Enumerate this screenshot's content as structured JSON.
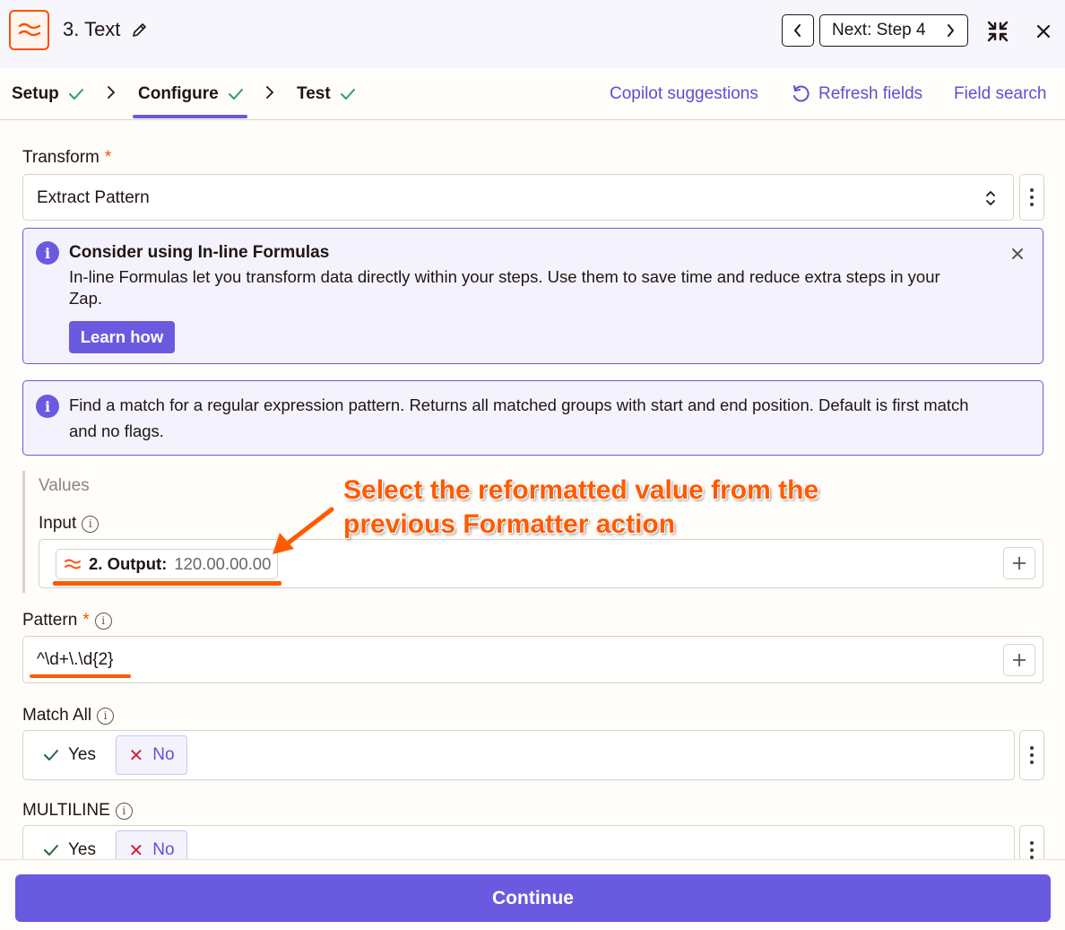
{
  "header": {
    "step_title": "3. Text",
    "next_label": "Next: Step 4"
  },
  "tabs": [
    {
      "label": "Setup"
    },
    {
      "label": "Configure"
    },
    {
      "label": "Test"
    }
  ],
  "tab_links": {
    "copilot": "Copilot suggestions",
    "refresh": "Refresh fields",
    "search": "Field search"
  },
  "transform": {
    "label": "Transform",
    "required": "*",
    "value": "Extract Pattern"
  },
  "formula_alert": {
    "title": "Consider using In-line Formulas",
    "line1": "In-line Formulas let you transform data directly within your steps. Use them to save time and reduce extra steps in your",
    "line2": "Zap.",
    "button": "Learn how"
  },
  "description_alert": {
    "line1": "Find a match for a regular expression pattern. Returns all matched groups with start and end position. Default is first match",
    "line2": "and no flags."
  },
  "values": {
    "heading": "Values",
    "input_label": "Input",
    "pill_key": "2. Output:",
    "pill_value": "120.00.00.00"
  },
  "pattern": {
    "label": "Pattern",
    "required": "*",
    "value": "^\\d+\\.\\d{2}"
  },
  "match_all": {
    "label": "Match All",
    "yes": "Yes",
    "no": "No"
  },
  "multiline": {
    "label": "MULTILINE",
    "yes": "Yes",
    "no": "No"
  },
  "footer": {
    "continue": "Continue"
  },
  "annotation": {
    "line1": "Select the reformatted value from the",
    "line2": "previous Formatter action"
  },
  "colors": {
    "accent": "#6a5ae0",
    "brand_orange": "#ff4f00",
    "annotation": "#ff5a00"
  }
}
